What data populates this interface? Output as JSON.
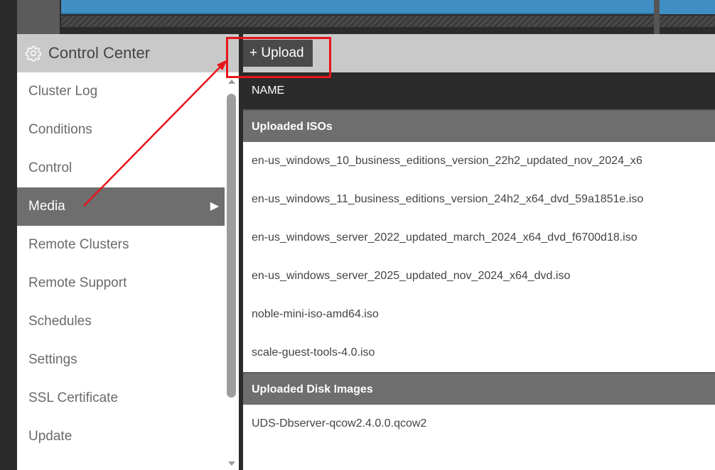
{
  "sidebar": {
    "title": "Control Center",
    "items": [
      {
        "label": "Cluster Log"
      },
      {
        "label": "Conditions"
      },
      {
        "label": "Control"
      },
      {
        "label": "Media"
      },
      {
        "label": "Remote Clusters"
      },
      {
        "label": "Remote Support"
      },
      {
        "label": "Schedules"
      },
      {
        "label": "Settings"
      },
      {
        "label": "SSL Certificate"
      },
      {
        "label": "Update"
      }
    ],
    "active_item": "Media"
  },
  "toolbar": {
    "upload_label": "+ Upload"
  },
  "table": {
    "column_header": "NAME",
    "groups": [
      {
        "label": "Uploaded ISOs",
        "files": [
          "en-us_windows_10_business_editions_version_22h2_updated_nov_2024_x6",
          "en-us_windows_11_business_editions_version_24h2_x64_dvd_59a1851e.iso",
          "en-us_windows_server_2022_updated_march_2024_x64_dvd_f6700d18.iso",
          "en-us_windows_server_2025_updated_nov_2024_x64_dvd.iso",
          "noble-mini-iso-amd64.iso",
          "scale-guest-tools-4.0.iso"
        ]
      },
      {
        "label": "Uploaded Disk Images",
        "files": [
          "UDS-Dbserver-qcow2.4.0.0.qcow2"
        ]
      }
    ]
  },
  "colors": {
    "accent_highlight": "#e8141b",
    "top_bar_blue": "#3f8fc4",
    "dark_chrome": "#2b2b2b",
    "active_item": "#6e6e6e"
  }
}
